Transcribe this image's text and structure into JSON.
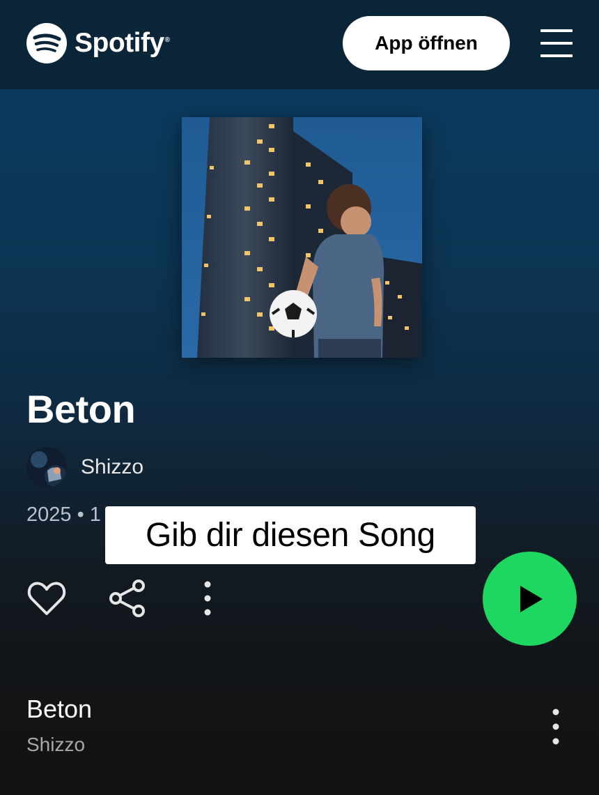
{
  "header": {
    "brand": "Spotify",
    "brand_mark": "®",
    "open_app_label": "App öffnen",
    "menu_icon": "hamburger-menu-icon"
  },
  "track": {
    "title": "Beton",
    "artist": "Shizzo",
    "meta": "2025 • 1"
  },
  "overlay": {
    "caption": "Gib dir diesen Song"
  },
  "actions": {
    "like_icon": "heart-icon",
    "share_icon": "share-icon",
    "more_icon": "more-options-icon",
    "play_icon": "play-icon"
  },
  "tracklist": [
    {
      "title": "Beton",
      "artist": "Shizzo"
    }
  ],
  "colors": {
    "accent_green": "#1ed760",
    "header_bg": "#0b2538",
    "bg_top": "#0b3a5e",
    "bg_bottom": "#121212"
  }
}
